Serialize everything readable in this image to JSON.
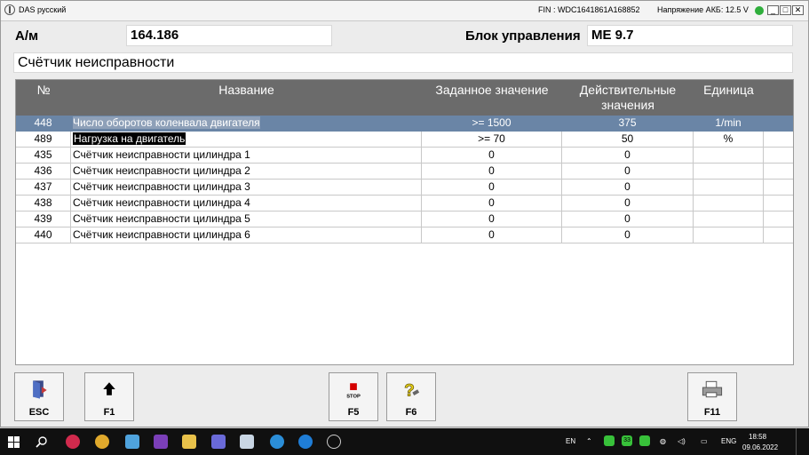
{
  "window": {
    "app_title": "DAS русский",
    "fin": "FIN : WDC1641861A168852",
    "battery_voltage": "Напряжение АКБ: 12.5 V",
    "status_color": "#2fae3c",
    "min_glyph": "_",
    "max_glyph": "□",
    "close_glyph": "✕"
  },
  "header": {
    "model_label": "А/м",
    "model_value": "164.186",
    "ecu_label": "Блок управления",
    "ecu_value": "ME 9.7"
  },
  "section_title": "Счётчик неисправности",
  "table": {
    "columns": [
      "№",
      "Название",
      "Заданное значение",
      "Действительные значения",
      "Единица"
    ],
    "rows": [
      {
        "no": "448",
        "name": "Число оборотов коленвала двигателя",
        "target": ">= 1500",
        "actual": "375",
        "unit": "1/min"
      },
      {
        "no": "489",
        "name": "Нагрузка на двигатель",
        "target": ">= 70",
        "actual": "50",
        "unit": "%"
      },
      {
        "no": "435",
        "name": "Счётчик неисправности цилиндра 1",
        "target": "0",
        "actual": "0",
        "unit": ""
      },
      {
        "no": "436",
        "name": "Счётчик неисправности цилиндра 2",
        "target": "0",
        "actual": "0",
        "unit": ""
      },
      {
        "no": "437",
        "name": "Счётчик неисправности цилиндра 3",
        "target": "0",
        "actual": "0",
        "unit": ""
      },
      {
        "no": "438",
        "name": "Счётчик неисправности цилиндра 4",
        "target": "0",
        "actual": "0",
        "unit": ""
      },
      {
        "no": "439",
        "name": "Счётчик неисправности цилиндра 5",
        "target": "0",
        "actual": "0",
        "unit": ""
      },
      {
        "no": "440",
        "name": "Счётчик неисправности цилиндра 6",
        "target": "0",
        "actual": "0",
        "unit": ""
      }
    ]
  },
  "buttons": {
    "esc": "ESC",
    "f1": "F1",
    "f5": "F5",
    "f5_icon_text": "STOP",
    "f6": "F6",
    "f11": "F11"
  },
  "taskbar": {
    "lang_short": "EN",
    "lang": "ENG",
    "time": "18:58",
    "date": "09.06.2022",
    "tray_badge": "33"
  }
}
